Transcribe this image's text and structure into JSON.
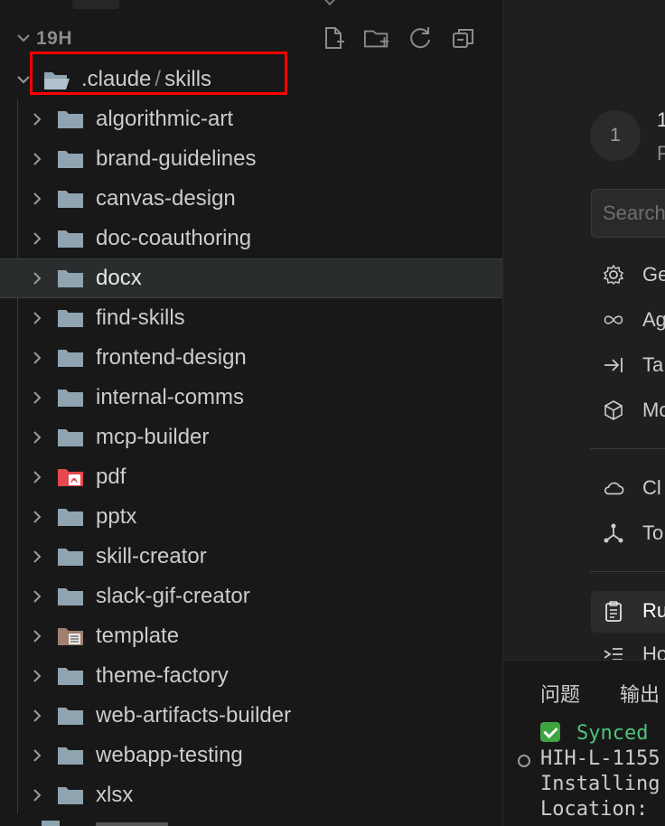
{
  "explorer": {
    "section_title": "19H",
    "header_actions": [
      {
        "name": "new-file-icon"
      },
      {
        "name": "new-folder-icon"
      },
      {
        "name": "refresh-icon"
      },
      {
        "name": "collapse-all-icon"
      }
    ],
    "root": {
      "path_parent": ".claude",
      "path_separator": "/",
      "path_child": "skills"
    },
    "folders": [
      {
        "label": "algorithmic-art",
        "icon": "folder-icon"
      },
      {
        "label": "brand-guidelines",
        "icon": "folder-icon"
      },
      {
        "label": "canvas-design",
        "icon": "folder-icon"
      },
      {
        "label": "doc-coauthoring",
        "icon": "folder-icon"
      },
      {
        "label": "docx",
        "icon": "folder-icon",
        "selected": true
      },
      {
        "label": "find-skills",
        "icon": "folder-icon"
      },
      {
        "label": "frontend-design",
        "icon": "folder-icon"
      },
      {
        "label": "internal-comms",
        "icon": "folder-icon"
      },
      {
        "label": "mcp-builder",
        "icon": "folder-icon"
      },
      {
        "label": "pdf",
        "icon": "pdf-folder-icon"
      },
      {
        "label": "pptx",
        "icon": "folder-icon"
      },
      {
        "label": "skill-creator",
        "icon": "folder-icon"
      },
      {
        "label": "slack-gif-creator",
        "icon": "folder-icon"
      },
      {
        "label": "template",
        "icon": "template-folder-icon"
      },
      {
        "label": "theme-factory",
        "icon": "folder-icon"
      },
      {
        "label": "web-artifacts-builder",
        "icon": "folder-icon"
      },
      {
        "label": "webapp-testing",
        "icon": "folder-icon"
      },
      {
        "label": "xlsx",
        "icon": "folder-icon"
      }
    ]
  },
  "settings_pane": {
    "step_number": "1",
    "step_title": "1",
    "step_subtitle": "P",
    "search_placeholder": "Search",
    "menu_group_1": [
      {
        "label": "Ge",
        "icon": "gear-icon"
      },
      {
        "label": "Ag",
        "icon": "infinity-icon"
      },
      {
        "label": "Ta",
        "icon": "tab-arrow-icon"
      },
      {
        "label": "Mo",
        "icon": "cube-icon"
      }
    ],
    "menu_group_2": [
      {
        "label": "Cl",
        "icon": "cloud-icon"
      },
      {
        "label": "To",
        "icon": "tools-network-icon"
      }
    ],
    "menu_group_3": [
      {
        "label": "Ru",
        "icon": "clipboard-icon",
        "active": true
      },
      {
        "label": "Ho",
        "icon": "hooks-icon"
      }
    ]
  },
  "panel": {
    "tabs": [
      "问题",
      "输出"
    ],
    "terminal_lines": [
      "Synced",
      "HIH-L-1155",
      "Installing",
      "Location:"
    ]
  },
  "colors": {
    "folder": "#8fa3b0",
    "pdf_folder": "#e5484d",
    "template_folder": "#a08070",
    "highlight": "#ff0000",
    "synced_text": "#4ec27b"
  }
}
